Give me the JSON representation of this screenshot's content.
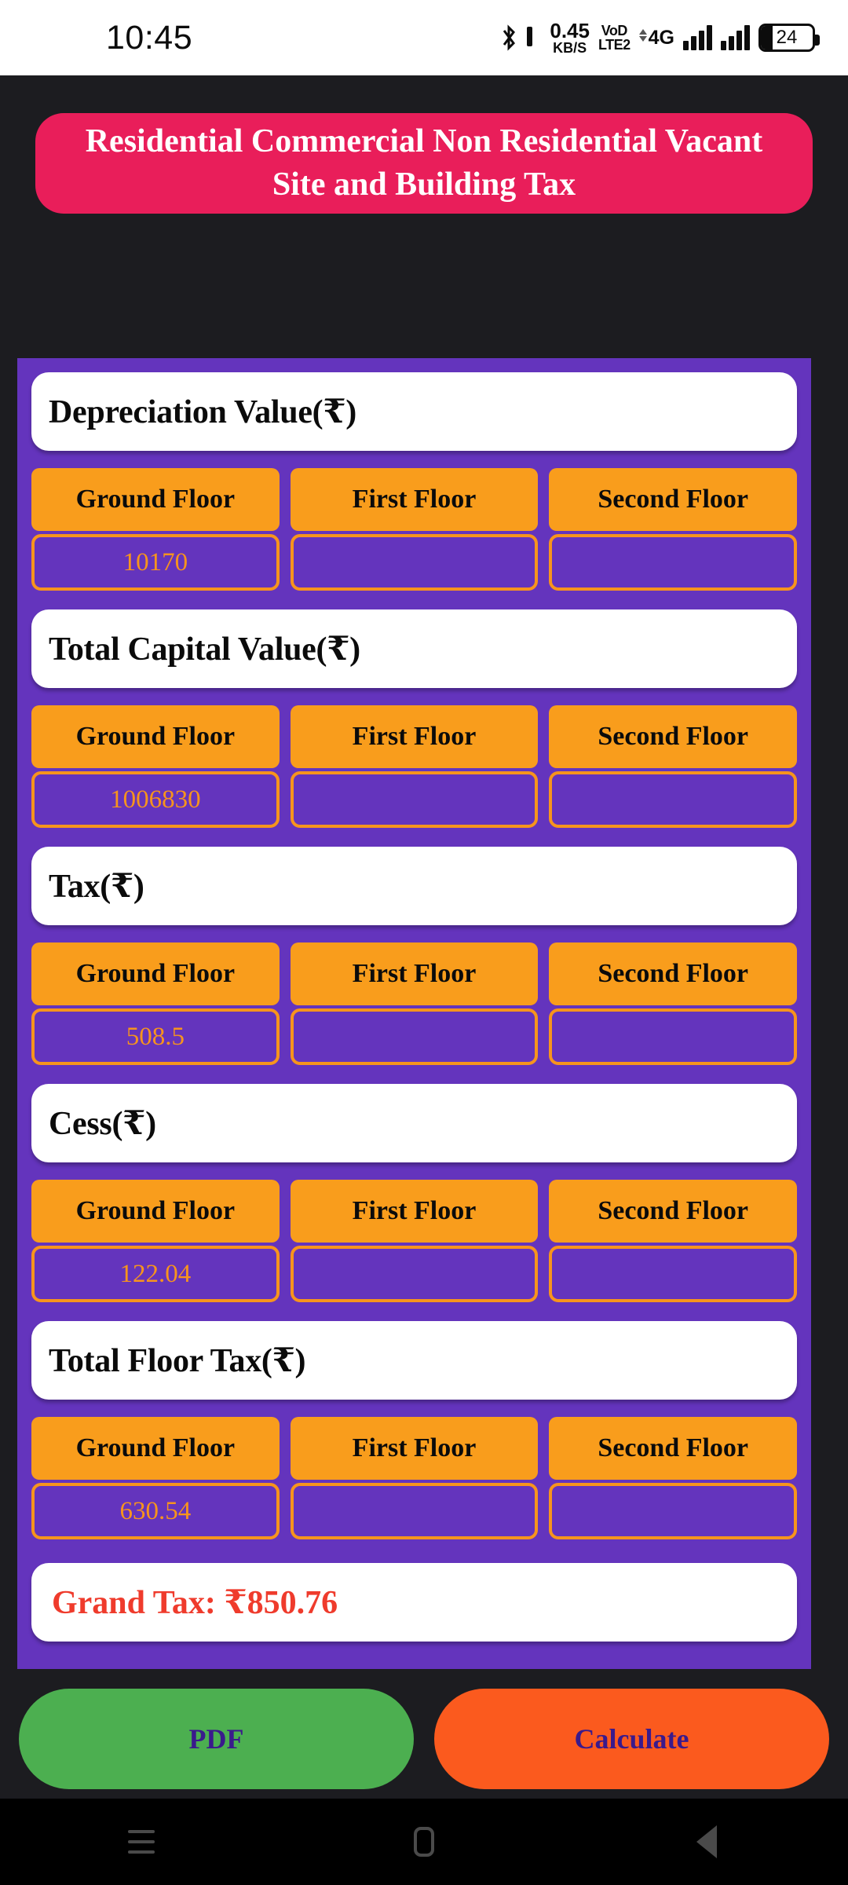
{
  "status_bar": {
    "time": "10:45",
    "bluetooth_icon": "bluetooth-icon",
    "data_speed_value": "0.45",
    "data_speed_unit": "KB/S",
    "volte_line1": "VoD",
    "volte_line2": "LTE2",
    "network_type": "4G",
    "battery_percent": "24"
  },
  "header": {
    "title": "Residential Commercial Non Residential Vacant Site and Building Tax",
    "background_color": "#e91e5a",
    "text_color": "#ffffff"
  },
  "theme": {
    "panel_color": "#6434bd",
    "accent_orange": "#f7941d",
    "header_pink": "#e91e5a",
    "grand_total_red": "#ef3b2c",
    "page_background": "#1c1c20"
  },
  "floor_columns": [
    "Ground Floor",
    "First Floor",
    "Second Floor"
  ],
  "sections": [
    {
      "label": "Depreciation Value(₹)",
      "values": [
        "10170",
        "",
        ""
      ]
    },
    {
      "label": "Total Capital Value(₹)",
      "values": [
        "1006830",
        "",
        ""
      ]
    },
    {
      "label": "Tax(₹)",
      "values": [
        "508.5",
        "",
        ""
      ]
    },
    {
      "label": "Cess(₹)",
      "values": [
        "122.04",
        "",
        ""
      ]
    },
    {
      "label": "Total Floor Tax(₹)",
      "values": [
        "630.54",
        "",
        ""
      ]
    }
  ],
  "grand_total": {
    "text": "Grand Tax: ₹850.76",
    "amount": "850.76",
    "currency": "₹"
  },
  "actions": {
    "pdf_label": "PDF",
    "calculate_label": "Calculate",
    "pdf_color": "#4caf50",
    "calculate_color": "#fb5a1e",
    "action_text_color": "#3a1a8c"
  },
  "navigation_bar": {
    "recents_icon": "recents-icon",
    "home_icon": "home-icon",
    "back_icon": "back-icon"
  }
}
